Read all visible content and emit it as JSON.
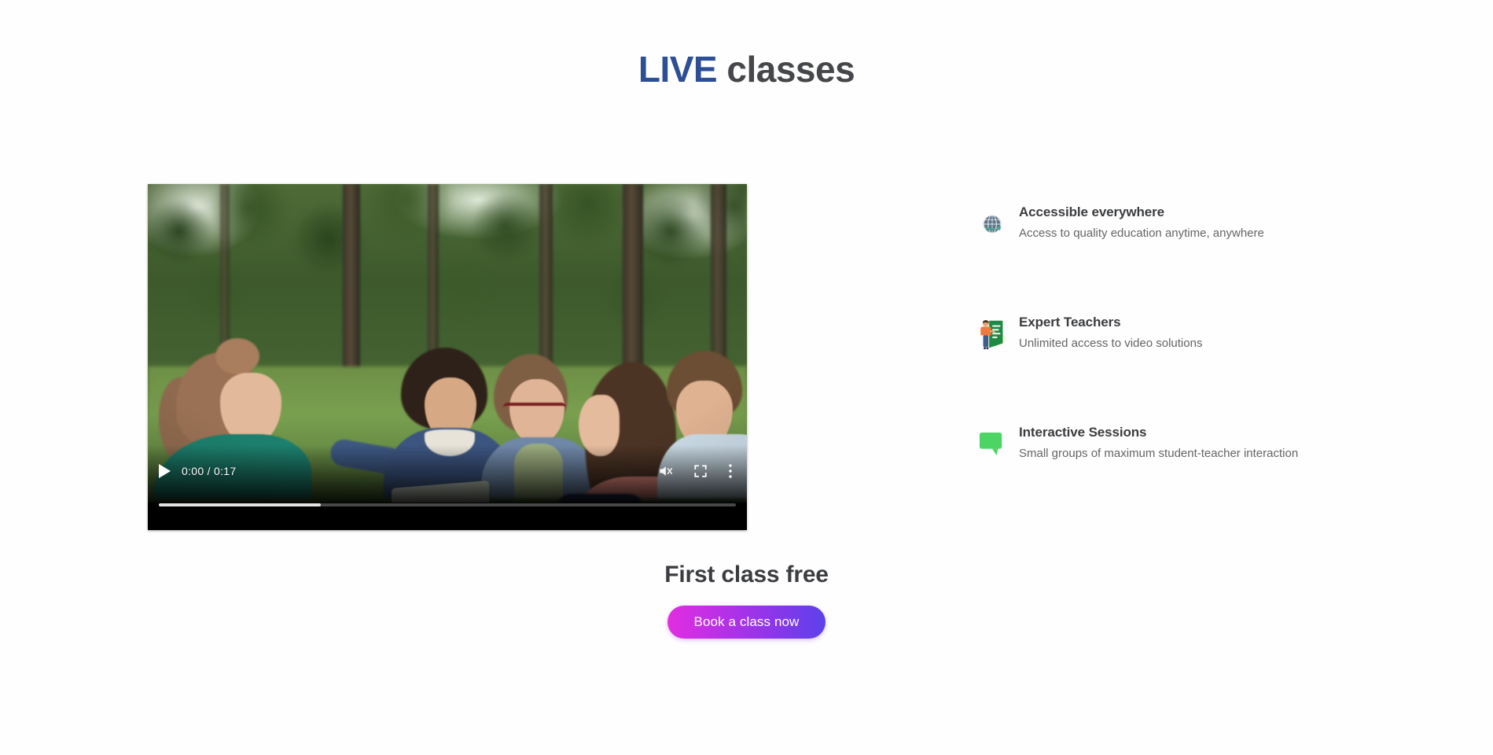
{
  "header": {
    "title_highlight": "LIVE",
    "title_rest": " classes",
    "highlight_color": "#2d4f95",
    "rest_color": "#46474a"
  },
  "video": {
    "play_label": "Play",
    "time_display": "0:00 / 0:17",
    "current_time": "0:00",
    "duration": "0:17",
    "buffered_percent": 28,
    "played_percent": 0,
    "muted": true,
    "mute_label": "Unmute",
    "fullscreen_label": "Full screen",
    "more_options_label": "More options",
    "scene_description": "Group of students sitting on grass in a park around a laptop"
  },
  "cta": {
    "heading": "First class free",
    "button_label": "Book a class now",
    "gradient_start": "#e22ee0",
    "gradient_end": "#5c42ea"
  },
  "features": [
    {
      "icon": "globe-icon",
      "title": "Accessible everywhere",
      "description": "Access to quality education anytime, anywhere"
    },
    {
      "icon": "teacher-board-icon",
      "title": "Expert Teachers",
      "description": "Unlimited access to video solutions"
    },
    {
      "icon": "speech-bubble-icon",
      "title": "Interactive Sessions",
      "description": "Small groups of maximum student-teacher interaction"
    }
  ]
}
